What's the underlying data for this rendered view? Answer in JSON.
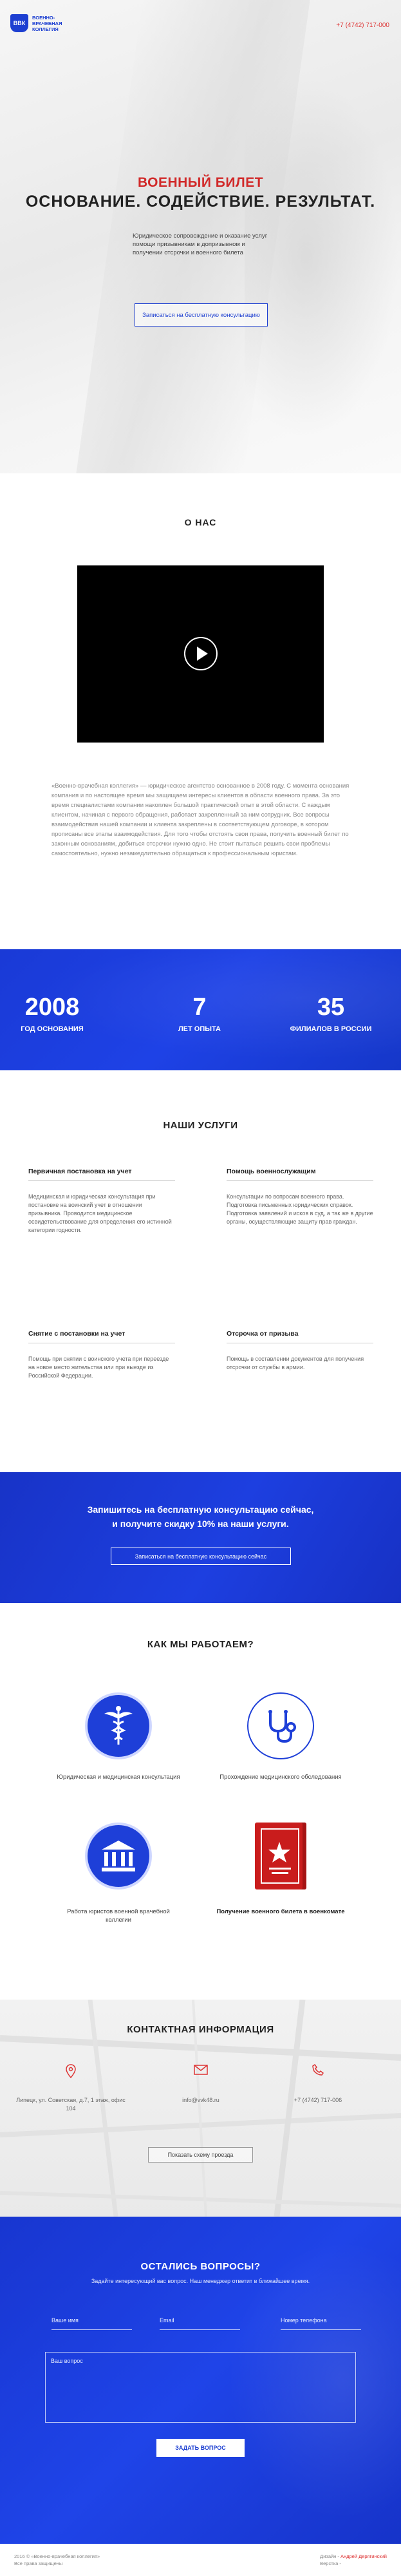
{
  "header": {
    "logo_badge": "ВВК",
    "logo_text": "Военно-врачебная коллегия",
    "phone": "+7 (4742) 717-000"
  },
  "hero": {
    "title_red": "ВОЕННЫЙ БИЛЕТ",
    "title_main": "ОСНОВАНИЕ. СОДЕЙСТВИЕ. РЕЗУЛЬТАТ.",
    "description": "Юридическое сопровождение и оказание услуг помощи призывникам в допризывном и получении отсрочки и военного билета",
    "cta_label": "Записаться на бесплатную консультацию"
  },
  "about": {
    "title": "О НАС",
    "text": "«Военно-врачебная коллегия» — юридическое агентство основанное в 2008 году. С момента основания компания и по настоящее время мы защищаем интересы клиентов в области военного права. За это время специалистами компании накоплен большой практический опыт в этой области. С каждым клиентом, начиная с первого обращения, работает закрепленный за ним сотрудник. Все вопросы взаимодействия нашей компании и клиента закреплены в соответствующем договоре, в котором прописаны все этапы взаимодействия. Для того чтобы отстоять свои права, получить военный билет по законным основаниям, добиться отсрочки нужно одно. Не стоит пытаться решить свои проблемы самостоятельно, нужно незамедлительно обращаться к профессиональным юристам."
  },
  "stats": [
    {
      "number": "2008",
      "label": "ГОД ОСНОВАНИЯ"
    },
    {
      "number": "7",
      "label": "ЛЕТ ОПЫТА"
    },
    {
      "number": "35",
      "label": "ФИЛИАЛОВ В РОССИИ"
    }
  ],
  "services": {
    "title": "НАШИ УСЛУГИ",
    "items": [
      {
        "name": "Первичная постановка на учет",
        "desc": "Медицинская и юридическая консультация при постановке на воинский учет в отношении призывника. Проводится медицинское освидетельствование для определения его истинной категории годности."
      },
      {
        "name": "Помощь военнослужащим",
        "desc": "Консультации по вопросам военного права. Подготовка письменных юридических справок. Подготовка заявлений и исков в суд, а так же в другие органы, осуществляющие защиту прав граждан."
      },
      {
        "name": "Снятие с постановки на учет",
        "desc": "Помощь при снятии с воинского учета при переезде на новое место жительства или при выезде из Российской Федерации."
      },
      {
        "name": "Отсрочка от призыва",
        "desc": "Помощь в составлении документов для получения отсрочки от службы в армии."
      }
    ]
  },
  "cta": {
    "line1": "Запишитесь на бесплатную консультацию сейчас,",
    "line2": "и получите скидку 10% на наши услуги.",
    "button": "Записаться на бесплатную консультацию сейчас"
  },
  "how": {
    "title": "КАК МЫ РАБОТАЕМ?",
    "steps": [
      {
        "label": "Юридическая и медицинская консультация",
        "icon": "caduceus-icon"
      },
      {
        "label": "Прохождение медицинского обследования",
        "icon": "stethoscope-icon"
      },
      {
        "label": "Работа юристов военной врачебной коллегии",
        "icon": "courthouse-icon"
      },
      {
        "label": "Получение военного билета в военкомате",
        "icon": "military-id-icon"
      }
    ]
  },
  "contacts": {
    "title": "КОНТАКТНАЯ ИНФОРМАЦИЯ",
    "address": "Липецк, ул. Советская, д.7, 1 этаж, офис 104",
    "email": "info@vvk48.ru",
    "phone": "+7 (4742) 717-006",
    "map_button": "Показать схему проезда"
  },
  "questions": {
    "title": "ОСТАЛИСЬ ВОПРОСЫ?",
    "subtitle": "Задайте интересующий вас вопрос. Наш менеджер ответит в ближайшее время.",
    "name_placeholder": "Ваше имя",
    "email_placeholder": "Email",
    "phone_placeholder": "Номер телефона",
    "question_placeholder": "Ваш вопрос",
    "submit": "ЗАДАТЬ ВОПРОС"
  },
  "footer": {
    "copyright": "2016 © «Военно-врачебная коллегия»",
    "rights": "Все права защищены",
    "design_prefix": "Дизайн - ",
    "designer": "Андрей Дерягинский",
    "dev": "Верстка -"
  },
  "colors": {
    "brand_blue": "#1d3fd1",
    "accent_red": "#d12a2a"
  }
}
